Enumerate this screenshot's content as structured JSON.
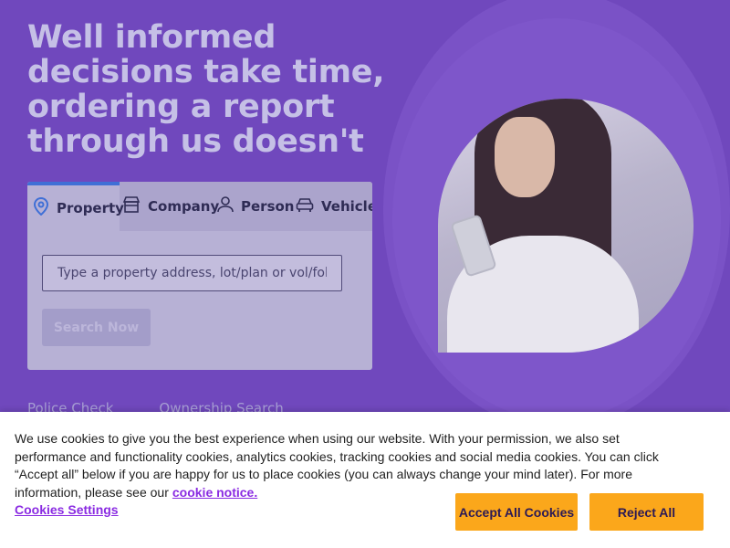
{
  "hero": {
    "headline": "Well informed decisions take time, ordering a report through us doesn't"
  },
  "search": {
    "tabs": [
      {
        "label": "Property",
        "icon": "location-pin-icon",
        "active": true
      },
      {
        "label": "Company",
        "icon": "storefront-icon",
        "active": false
      },
      {
        "label": "Person",
        "icon": "person-icon",
        "active": false
      },
      {
        "label": "Vehicle",
        "icon": "car-icon",
        "active": false
      }
    ],
    "placeholder": "Type a property address, lot/plan or vol/fol",
    "button_label": "Search Now"
  },
  "quick_links": [
    {
      "label": "Police Check"
    },
    {
      "label": "Ownership Search"
    }
  ],
  "cookie_banner": {
    "text": "We use cookies to give you the best experience when using our website. With your permission, we also set performance and functionality cookies, analytics cookies, tracking cookies and social media cookies. You can click “Accept all” below if you are happy for us to place cookies (you can always change your mind later). For more information, please see our",
    "notice_link": "cookie notice.",
    "settings_label": "Cookies Settings",
    "accept_label": "Accept All Cookies",
    "reject_label": "Reject All"
  },
  "colors": {
    "background": "#7048bd",
    "accent_orange": "#fba71b",
    "link_purple": "#8a2be2",
    "active_tab_border": "#3f6fd6"
  }
}
